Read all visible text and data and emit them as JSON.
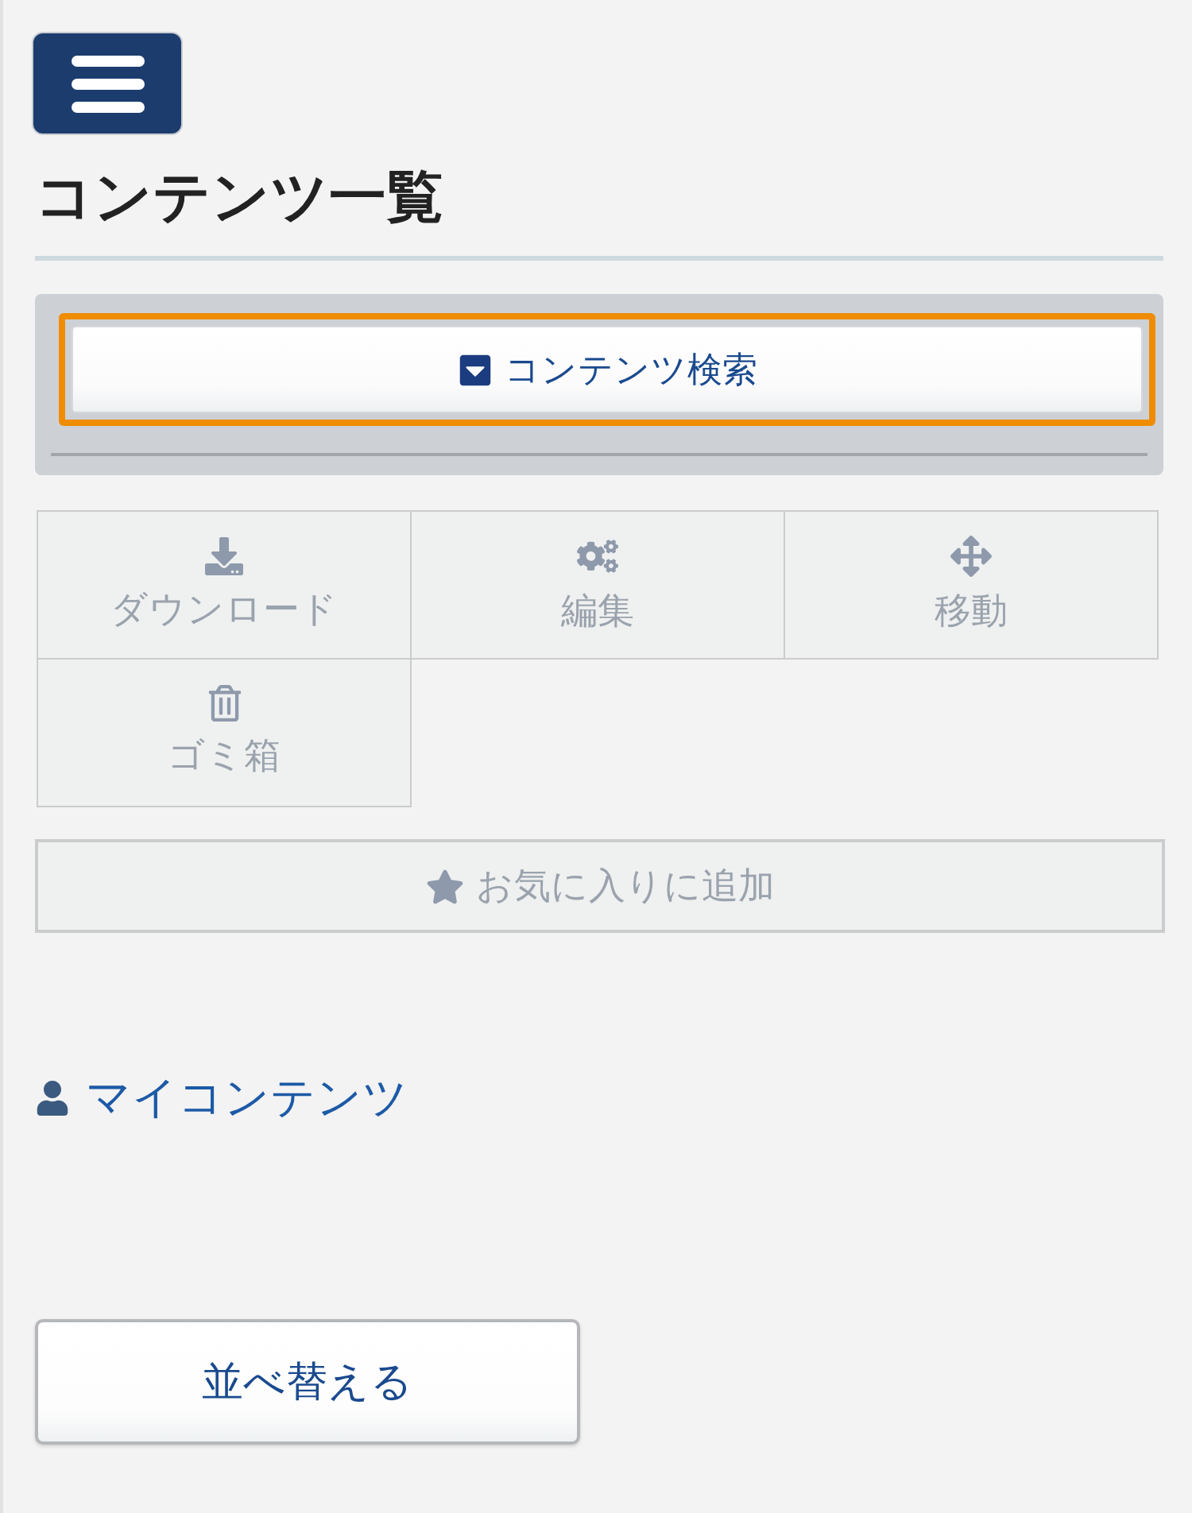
{
  "page_title": "コンテンツ一覧",
  "search_panel": {
    "toggle_label": "コンテンツ検索",
    "expanded": false,
    "focused": true
  },
  "actions": [
    {
      "kind": "download",
      "label": "ダウンロード",
      "disabled": true
    },
    {
      "kind": "edit",
      "label": "編集",
      "disabled": true
    },
    {
      "kind": "move",
      "label": "移動",
      "disabled": true
    },
    {
      "kind": "trash",
      "label": "ゴミ箱",
      "disabled": true
    }
  ],
  "favorite_button": {
    "label": "お気に入りに追加",
    "disabled": true
  },
  "my_contents_link": "マイコンテンツ",
  "sort_button": "並べ替える"
}
